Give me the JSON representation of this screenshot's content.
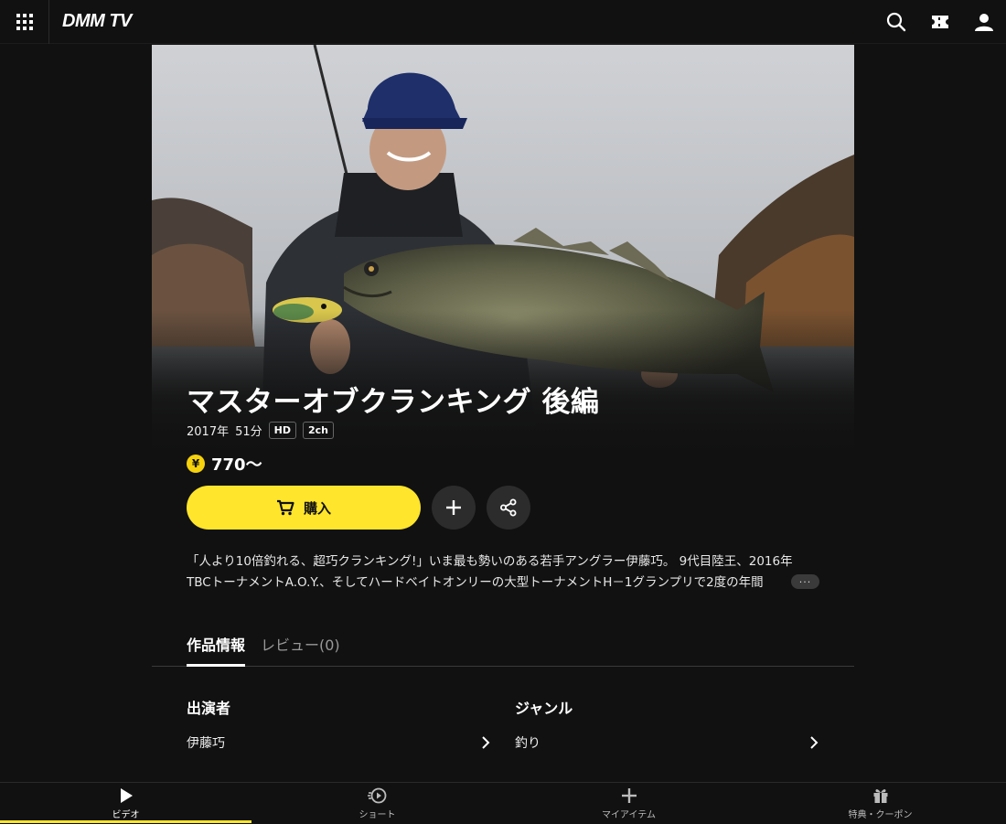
{
  "header": {
    "logo": "DMM TV"
  },
  "hero": {
    "title": "マスターオブクランキング 後編",
    "year": "2017年",
    "duration": "51分",
    "badges": [
      "HD",
      "2ch"
    ]
  },
  "price": {
    "yen_symbol": "¥",
    "value": "770～"
  },
  "actions": {
    "buy_label": "購入"
  },
  "description": {
    "line1": "「人より10倍釣れる、超巧クランキング!」いま最も勢いのある若手アングラー伊藤巧。 9代目陸王、2016年",
    "line2": "TBCトーナメントA.O.Y.、そしてハードベイトオンリーの大型トーナメントH－1グランプリで2度の年間",
    "more": "···"
  },
  "tabs": [
    {
      "label": "作品情報"
    },
    {
      "label": "レビュー(0)"
    }
  ],
  "sections": {
    "cast": {
      "heading": "出演者",
      "item": "伊藤巧"
    },
    "genre": {
      "heading": "ジャンル",
      "item": "釣り"
    }
  },
  "bottom_nav": [
    {
      "label": "ビデオ",
      "icon": "play-icon"
    },
    {
      "label": "ショート",
      "icon": "short-play-icon"
    },
    {
      "label": "マイアイテム",
      "icon": "plus-icon"
    },
    {
      "label": "特典・クーポン",
      "icon": "gift-icon"
    }
  ],
  "colors": {
    "accent": "#ffe52b",
    "background": "#111111"
  }
}
